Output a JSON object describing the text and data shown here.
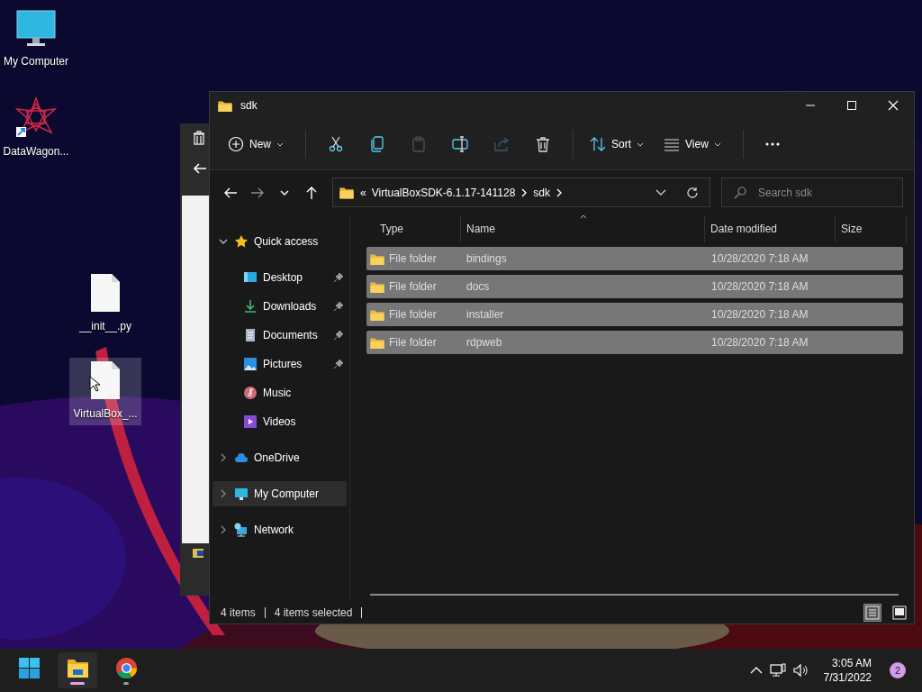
{
  "desktop_icons": [
    {
      "kind": "computer",
      "label": "My Computer",
      "selected": false
    },
    {
      "kind": "app",
      "label": "DataWagon...",
      "selected": false
    },
    {
      "kind": "file",
      "label": "__init__.py",
      "selected": false
    },
    {
      "kind": "file",
      "label": "VirtualBox_...",
      "selected": true
    }
  ],
  "explorer": {
    "title": "sdk",
    "toolbar": [
      {
        "kind": "new",
        "label": "New",
        "disabled": false
      },
      {
        "kind": "cut",
        "disabled": false
      },
      {
        "kind": "copy",
        "disabled": false
      },
      {
        "kind": "paste",
        "disabled": true
      },
      {
        "kind": "rename",
        "disabled": false
      },
      {
        "kind": "share",
        "disabled": true
      },
      {
        "kind": "delete",
        "disabled": false
      },
      {
        "kind": "sort",
        "label": "Sort",
        "disabled": false
      },
      {
        "kind": "view",
        "label": "View",
        "disabled": false
      },
      {
        "kind": "more",
        "disabled": false
      }
    ],
    "nav_buttons": [
      {
        "kind": "back",
        "disabled": false
      },
      {
        "kind": "forward",
        "disabled": true
      },
      {
        "kind": "recent",
        "disabled": false
      },
      {
        "kind": "up",
        "disabled": false
      }
    ],
    "address": {
      "overflow": "«",
      "segments": [
        "VirtualBoxSDK-6.1.17-141128",
        "sdk"
      ]
    },
    "search": {
      "placeholder": "Search sdk"
    },
    "navigation": [
      {
        "kind": "star",
        "label": "Quick access",
        "expanded": true,
        "selected": false,
        "children": [
          {
            "kind": "desktop",
            "label": "Desktop",
            "pinned": true,
            "selected": false
          },
          {
            "kind": "download",
            "label": "Downloads",
            "pinned": true,
            "selected": false
          },
          {
            "kind": "documents",
            "label": "Documents",
            "pinned": true,
            "selected": false
          },
          {
            "kind": "pictures",
            "label": "Pictures",
            "pinned": true,
            "selected": false
          },
          {
            "kind": "music",
            "label": "Music",
            "pinned": false,
            "selected": false
          },
          {
            "kind": "videos",
            "label": "Videos",
            "pinned": false,
            "selected": false
          }
        ]
      },
      {
        "kind": "cloud",
        "label": "OneDrive",
        "expanded": false,
        "selected": false
      },
      {
        "kind": "computer",
        "label": "My Computer",
        "expanded": false,
        "selected": true
      },
      {
        "kind": "network",
        "label": "Network",
        "expanded": false,
        "selected": false
      }
    ],
    "columns": [
      {
        "label": "Type",
        "sorted": false
      },
      {
        "label": "Name",
        "sorted": true
      },
      {
        "label": "Date modified",
        "sorted": false
      },
      {
        "label": "Size",
        "sorted": false
      }
    ],
    "rows": [
      {
        "type": "File folder",
        "name": "bindings",
        "date_modified": "10/28/2020 7:18 AM",
        "selected": true
      },
      {
        "type": "File folder",
        "name": "docs",
        "date_modified": "10/28/2020 7:18 AM",
        "selected": true
      },
      {
        "type": "File folder",
        "name": "installer",
        "date_modified": "10/28/2020 7:18 AM",
        "selected": true
      },
      {
        "type": "File folder",
        "name": "rdpweb",
        "date_modified": "10/28/2020 7:18 AM",
        "selected": true
      }
    ],
    "status_bar": {
      "item_count": "4 items",
      "selection": "4 items selected"
    },
    "view_modes": [
      {
        "kind": "details",
        "selected": true
      },
      {
        "kind": "tiles",
        "selected": false
      }
    ]
  },
  "taskbar": {
    "apps": [
      {
        "kind": "start",
        "running": false,
        "active": false
      },
      {
        "kind": "explorer",
        "running": true,
        "active": true
      },
      {
        "kind": "chrome",
        "running": true,
        "active": false
      }
    ],
    "time": "3:05 AM",
    "date": "7/31/2022",
    "notifications": "2"
  }
}
